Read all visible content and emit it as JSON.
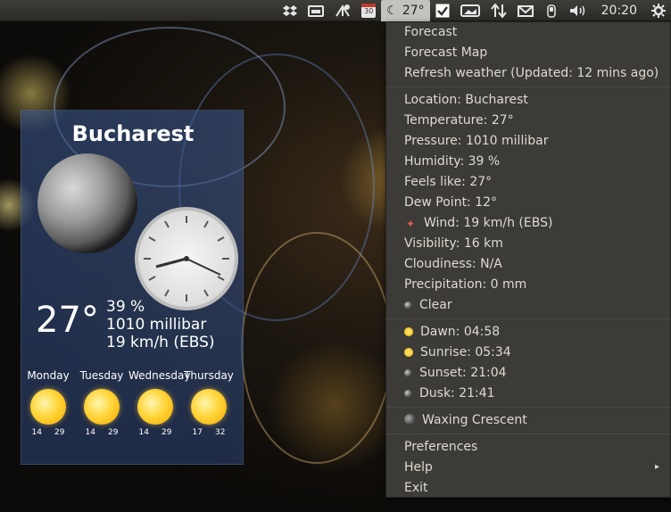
{
  "panel": {
    "tray_icons": [
      "dropbox-icon",
      "drive-icon",
      "network-icon",
      "calendar-icon"
    ],
    "calendar_day": "30",
    "weather_indicator": {
      "icon": "moon-icon",
      "temp": "27°"
    },
    "right_icons": [
      "checkbox-icon",
      "screen-icon",
      "transfer-icon",
      "mail-icon",
      "battery-icon",
      "volume-icon"
    ],
    "clock": "20:20",
    "gear_icon": "gear-icon"
  },
  "widget": {
    "city": "Bucharest",
    "temp": "27°",
    "humidity": "39 %",
    "pressure": "1010 millibar",
    "wind": "19 km/h (EBS)",
    "forecast": [
      {
        "day": "Monday",
        "low": "14",
        "high": "29"
      },
      {
        "day": "Tuesday",
        "low": "14",
        "high": "29"
      },
      {
        "day": "Wednesday",
        "low": "14",
        "high": "29"
      },
      {
        "day": "Thursday",
        "low": "17",
        "high": "32"
      }
    ]
  },
  "menu": {
    "forecast": "Forecast",
    "forecast_map": "Forecast Map",
    "refresh": "Refresh weather (Updated: 12 mins ago)",
    "location": "Location: Bucharest",
    "temperature": "Temperature: 27°",
    "pressure": "Pressure: 1010 millibar",
    "humidity": "Humidity: 39 %",
    "feels_like": "Feels like: 27°",
    "dew_point": "Dew Point: 12°",
    "wind": "Wind: 19 km/h (EBS)",
    "visibility": "Visibility: 16 km",
    "cloudiness": "Cloudiness: N/A",
    "precipitation": "Precipitation: 0 mm",
    "condition": "Clear",
    "dawn": "Dawn: 04:58",
    "sunrise": "Sunrise: 05:34",
    "sunset": "Sunset: 21:04",
    "dusk": "Dusk: 21:41",
    "moon_phase": "Waxing Crescent",
    "preferences": "Preferences",
    "help": "Help",
    "exit": "Exit",
    "help_arrow": "▸"
  }
}
